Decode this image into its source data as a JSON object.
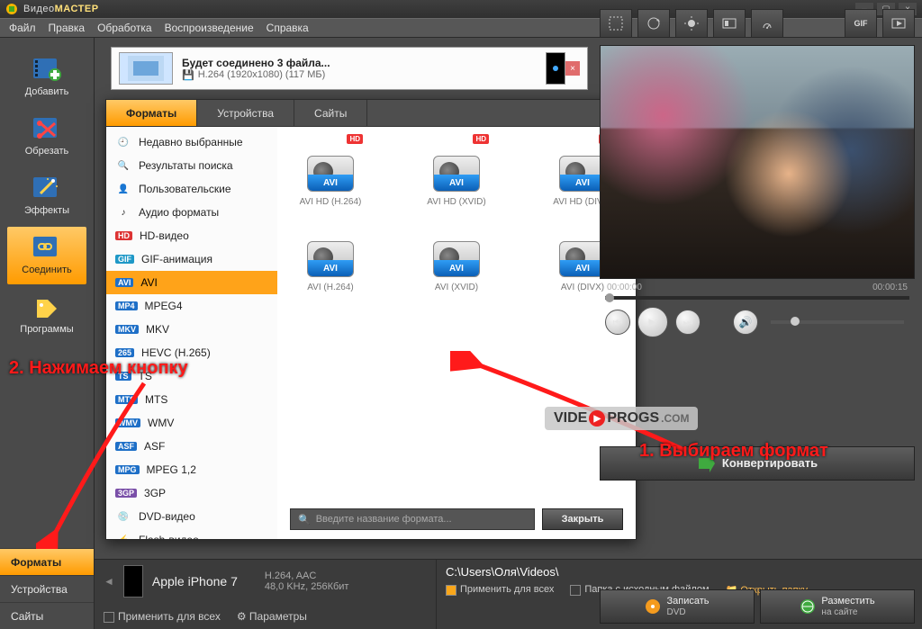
{
  "app": {
    "title_plain": "Видео",
    "title_bold": "МАСТЕР"
  },
  "menu": [
    "Файл",
    "Правка",
    "Обработка",
    "Воспроизведение",
    "Справка"
  ],
  "sidebar": {
    "items": [
      {
        "label": "Добавить",
        "icon": "film-plus"
      },
      {
        "label": "Обрезать",
        "icon": "film-scissors"
      },
      {
        "label": "Эффекты",
        "icon": "film-wand"
      },
      {
        "label": "Соединить",
        "icon": "film-chain",
        "active": true
      },
      {
        "label": "Программы",
        "icon": "tag"
      }
    ]
  },
  "bl_tabs": [
    {
      "label": "Форматы",
      "active": true
    },
    {
      "label": "Устройства"
    },
    {
      "label": "Сайты"
    }
  ],
  "filecard": {
    "title": "Будет соединено 3 файла...",
    "sub": "H.264 (1920x1080) (117 МБ)"
  },
  "dialog": {
    "tabs": [
      {
        "label": "Форматы",
        "active": true
      },
      {
        "label": "Устройства"
      },
      {
        "label": "Сайты"
      }
    ],
    "categories": [
      {
        "label": "Недавно выбранные",
        "icon": "clock"
      },
      {
        "label": "Результаты поиска",
        "icon": "search"
      },
      {
        "label": "Пользовательские",
        "icon": "user"
      },
      {
        "label": "Аудио форматы",
        "icon": "note"
      },
      {
        "label": "HD-видео",
        "badge": "HD",
        "badgeColor": "#d33"
      },
      {
        "label": "GIF-анимация",
        "badge": "GIF",
        "badgeColor": "#1e98c7"
      },
      {
        "label": "AVI",
        "badge": "AVI",
        "badgeColor": "#1e6fc7",
        "active": true
      },
      {
        "label": "MPEG4",
        "badge": "MP4",
        "badgeColor": "#1e6fc7"
      },
      {
        "label": "MKV",
        "badge": "MKV",
        "badgeColor": "#1e6fc7"
      },
      {
        "label": "HEVC (H.265)",
        "badge": "265",
        "badgeColor": "#1e6fc7"
      },
      {
        "label": "TS",
        "badge": "TS",
        "badgeColor": "#1e6fc7"
      },
      {
        "label": "MTS",
        "badge": "MTS",
        "badgeColor": "#1e6fc7"
      },
      {
        "label": "WMV",
        "badge": "WMV",
        "badgeColor": "#1e6fc7"
      },
      {
        "label": "ASF",
        "badge": "ASF",
        "badgeColor": "#1e6fc7"
      },
      {
        "label": "MPEG 1,2",
        "badge": "MPG",
        "badgeColor": "#1e6fc7"
      },
      {
        "label": "3GP",
        "badge": "3GP",
        "badgeColor": "#7a4fa8"
      },
      {
        "label": "DVD-видео",
        "icon": "dvd"
      },
      {
        "label": "Flash-видео",
        "icon": "flash"
      }
    ],
    "formats": [
      {
        "label": "AVI HD (H.264)",
        "band": "AVI",
        "hd": true
      },
      {
        "label": "AVI HD (XVID)",
        "band": "AVI",
        "hd": true
      },
      {
        "label": "AVI HD (DIVX)",
        "band": "AVI",
        "hd": true
      },
      {
        "label": "AVI (H.264)",
        "band": "AVI"
      },
      {
        "label": "AVI (XVID)",
        "band": "AVI"
      },
      {
        "label": "AVI (DIVX)",
        "band": "AVI"
      }
    ],
    "search_placeholder": "Введите название формата...",
    "close": "Закрыть"
  },
  "bottom": {
    "device": "Apple iPhone 7",
    "device_sub": "H.264, AAC",
    "device_sub2": "48,0 KHz, 256Кбит",
    "apply_all": "Применить для всех",
    "params": "Параметры",
    "path": "C:\\Users\\Оля\\Videos\\",
    "mid_apply": "Применить для всех",
    "mid_source": "Папка с исходным файлом",
    "open_folder": "Открыть папку"
  },
  "right": {
    "tools": [
      "crop",
      "rotate",
      "brightness",
      "effects",
      "speed",
      "",
      "gif",
      "frame"
    ],
    "time_cur": "00:00:00",
    "time_total": "00:00:15",
    "convert": "Конвертировать",
    "burn1": "Записать",
    "burn2": "DVD",
    "pub1": "Разместить",
    "pub2": "на сайте"
  },
  "annotations": {
    "step1": "1. Выбираем формат",
    "step2": "2. Нажимаем кнопку"
  },
  "watermark": {
    "a": "VIDE",
    "b": "PROGS",
    "c": ".COM"
  }
}
